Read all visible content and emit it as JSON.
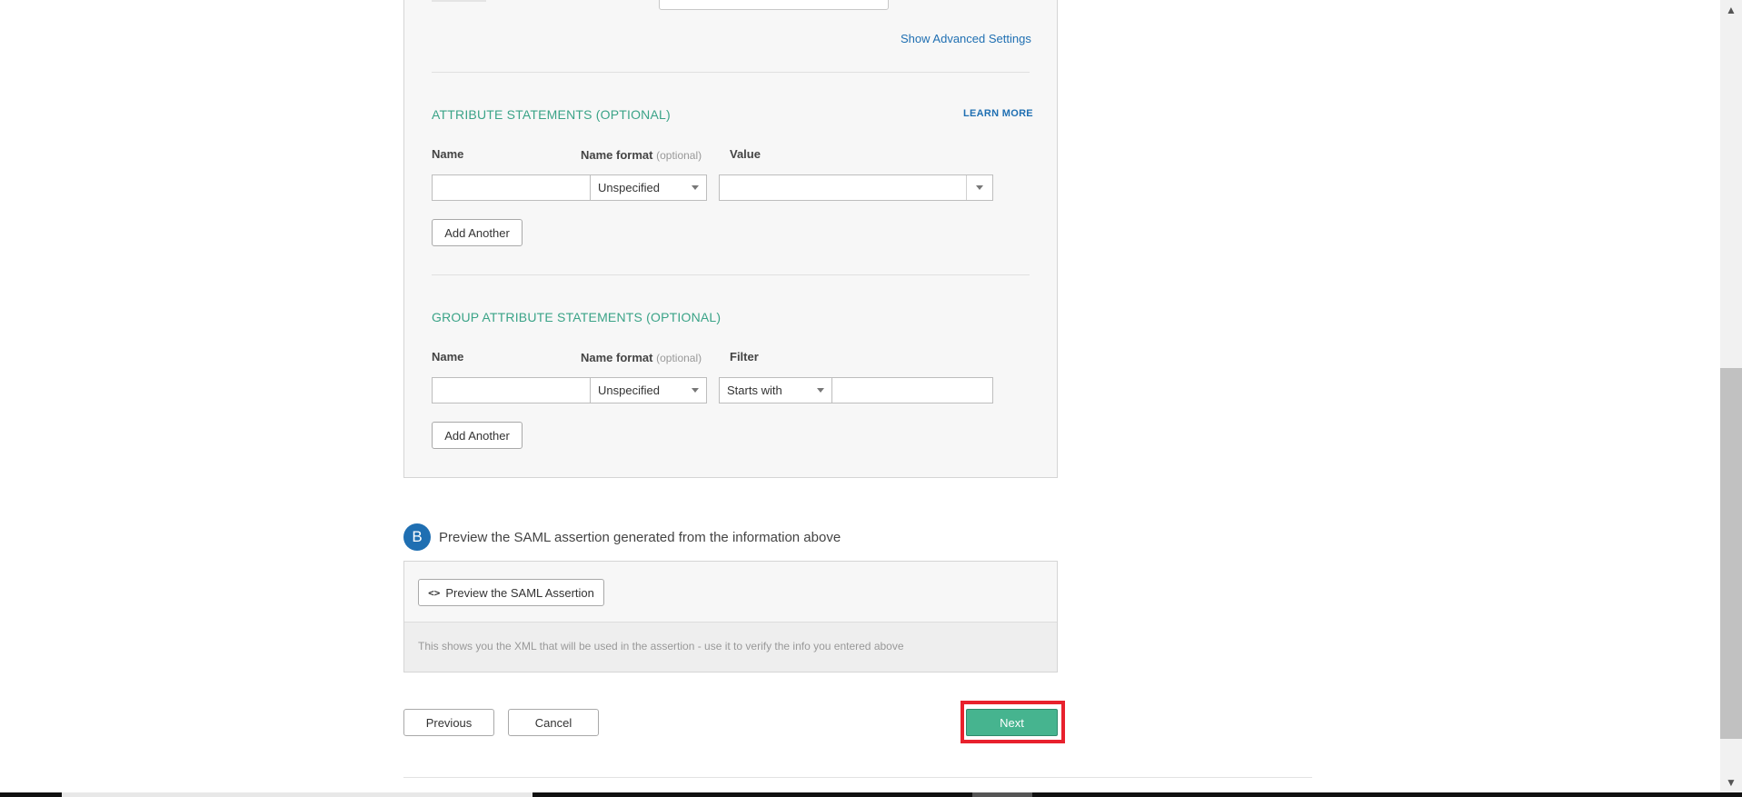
{
  "advanced_link": "Show Advanced Settings",
  "attribute_statements": {
    "title": "ATTRIBUTE STATEMENTS (OPTIONAL)",
    "learn_more": "LEARN MORE",
    "col_name": "Name",
    "col_format": "Name format",
    "col_format_hint": "(optional)",
    "col_value": "Value",
    "format_value": "Unspecified",
    "add_another": "Add Another"
  },
  "group_attribute_statements": {
    "title": "GROUP ATTRIBUTE STATEMENTS (OPTIONAL)",
    "col_name": "Name",
    "col_format": "Name format",
    "col_format_hint": "(optional)",
    "col_filter": "Filter",
    "format_value": "Unspecified",
    "filter_value": "Starts with",
    "add_another": "Add Another"
  },
  "step_b": {
    "badge": "B",
    "text": "Preview the SAML assertion generated from the information above",
    "preview_button": "Preview the SAML Assertion",
    "preview_icon": "<>",
    "hint": "This shows you the XML that will be used in the assertion - use it to verify the info you entered above"
  },
  "nav": {
    "previous": "Previous",
    "cancel": "Cancel",
    "next": "Next"
  },
  "scrollbar": {
    "up": "▲",
    "down": "▼"
  },
  "colors": {
    "accent_blue": "#1f6fb2",
    "accent_green": "#46b48f",
    "highlight_red": "#e8212d"
  }
}
